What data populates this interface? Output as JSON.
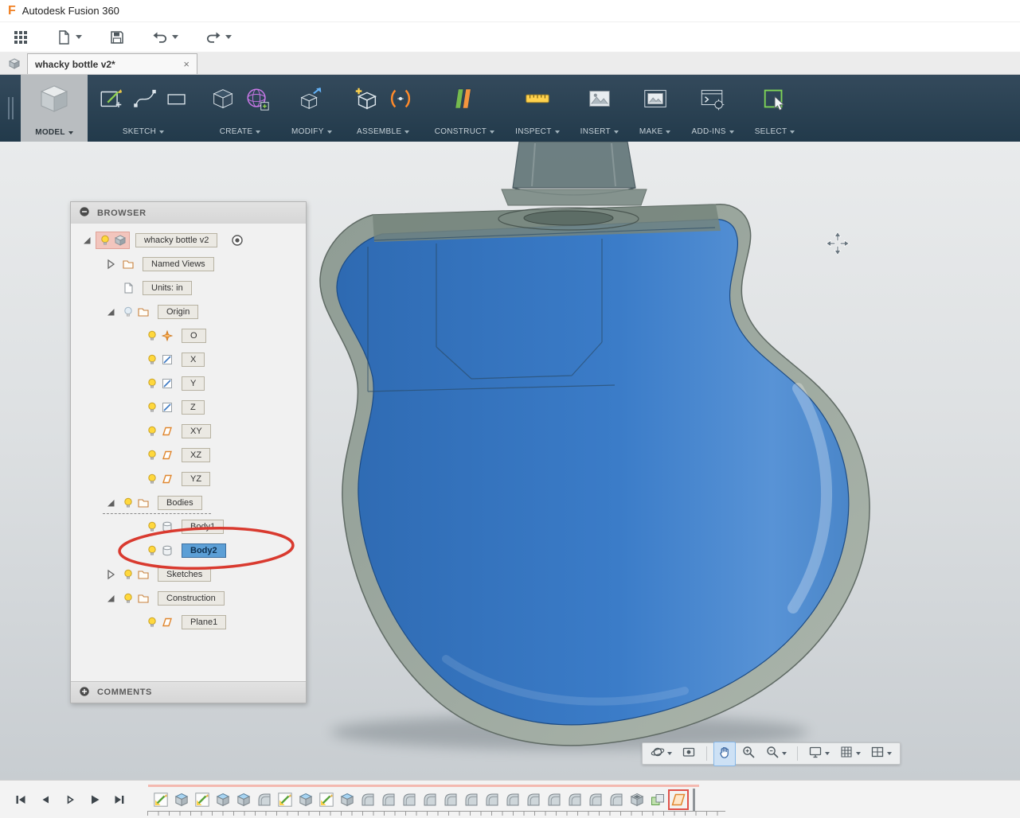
{
  "window": {
    "title": "Autodesk Fusion 360"
  },
  "quick_access": {
    "buttons": [
      {
        "name": "app-launcher-button",
        "icon": "app-grid-icon",
        "caret": false
      },
      {
        "name": "file-menu-button",
        "icon": "file-icon",
        "caret": true
      },
      {
        "name": "save-button",
        "icon": "save-icon",
        "caret": false
      },
      {
        "name": "undo-button",
        "icon": "undo-icon",
        "caret": true
      },
      {
        "name": "redo-button",
        "icon": "redo-icon",
        "caret": true
      }
    ]
  },
  "document_tab": {
    "label": "whacky bottle v2*",
    "close": "×"
  },
  "ribbon": {
    "model_label": "MODEL",
    "groups": [
      {
        "label": "SKETCH",
        "icons": [
          "create-sketch-icon",
          "spline-icon",
          "rectangle-icon"
        ]
      },
      {
        "label": "CREATE",
        "icons": [
          "box-icon",
          "form-icon"
        ]
      },
      {
        "label": "MODIFY",
        "icons": [
          "press-pull-icon"
        ]
      },
      {
        "label": "ASSEMBLE",
        "icons": [
          "new-component-icon",
          "joint-icon"
        ]
      },
      {
        "label": "CONSTRUCT",
        "icons": [
          "construction-plane-icon"
        ]
      },
      {
        "label": "INSPECT",
        "icons": [
          "measure-icon"
        ]
      },
      {
        "label": "INSERT",
        "icons": [
          "image-icon"
        ]
      },
      {
        "label": "MAKE",
        "icons": [
          "print-icon"
        ]
      },
      {
        "label": "ADD-INS",
        "icons": [
          "scripts-icon"
        ]
      },
      {
        "label": "SELECT",
        "icons": [
          "select-icon"
        ]
      }
    ]
  },
  "browser": {
    "header": "BROWSER",
    "comments_label": "COMMENTS",
    "items": [
      {
        "label": "whacky bottle v2",
        "depth": 0,
        "expander": "expanded",
        "bulb": "on",
        "icon": "component",
        "root": true,
        "radio": true
      },
      {
        "label": "Named Views",
        "depth": 1,
        "expander": "collapsed",
        "icon": "folder"
      },
      {
        "label": "Units: in",
        "depth": 1,
        "icon": "document"
      },
      {
        "label": "Origin",
        "depth": 1,
        "expander": "expanded",
        "bulb": "off",
        "icon": "folder"
      },
      {
        "label": "O",
        "depth": 2,
        "bulb": "on",
        "icon": "origin-point"
      },
      {
        "label": "X",
        "depth": 2,
        "bulb": "on",
        "icon": "axis"
      },
      {
        "label": "Y",
        "depth": 2,
        "bulb": "on",
        "icon": "axis"
      },
      {
        "label": "Z",
        "depth": 2,
        "bulb": "on",
        "icon": "axis"
      },
      {
        "label": "XY",
        "depth": 2,
        "bulb": "on",
        "icon": "plane"
      },
      {
        "label": "XZ",
        "depth": 2,
        "bulb": "on",
        "icon": "plane"
      },
      {
        "label": "YZ",
        "depth": 2,
        "bulb": "on",
        "icon": "plane"
      },
      {
        "label": "Bodies",
        "depth": 1,
        "expander": "expanded",
        "bulb": "on",
        "icon": "folder",
        "dotted": true
      },
      {
        "label": "Body1",
        "depth": 2,
        "bulb": "on",
        "icon": "body"
      },
      {
        "label": "Body2",
        "depth": 2,
        "bulb": "on",
        "icon": "body",
        "selected": true,
        "annotated": true
      },
      {
        "label": "Sketches",
        "depth": 1,
        "expander": "collapsed",
        "bulb": "on",
        "icon": "folder"
      },
      {
        "label": "Construction",
        "depth": 1,
        "expander": "expanded",
        "bulb": "on",
        "icon": "folder"
      },
      {
        "label": "Plane1",
        "depth": 2,
        "bulb": "on",
        "icon": "plane"
      }
    ]
  },
  "navbar": {
    "items": [
      {
        "name": "orbit",
        "icon": "orbit-icon",
        "caret": true
      },
      {
        "name": "look-at",
        "icon": "look-at-icon"
      },
      {
        "sep": true
      },
      {
        "name": "pan",
        "icon": "pan-icon",
        "active": true
      },
      {
        "name": "zoom",
        "icon": "zoom-icon"
      },
      {
        "name": "zoom-window",
        "icon": "zoom-window-icon",
        "caret": true
      },
      {
        "sep": true
      },
      {
        "name": "display-settings",
        "icon": "display-settings-icon",
        "caret": true
      },
      {
        "name": "grid-display",
        "icon": "grid-display-icon",
        "caret": true
      },
      {
        "name": "viewports",
        "icon": "viewports-icon",
        "caret": true
      }
    ]
  },
  "timeline": {
    "playback": [
      "go-to-start",
      "step-back",
      "step-forward",
      "play",
      "go-to-end"
    ],
    "features": [
      "sketch",
      "extrude",
      "sketch",
      "extrude",
      "extrude",
      "fillet",
      "sketch",
      "extrude",
      "sketch",
      "extrude",
      "fillet",
      "fillet",
      "fillet",
      "fillet",
      "fillet",
      "fillet",
      "fillet",
      "fillet",
      "fillet",
      "fillet",
      "fillet",
      "fillet",
      "fillet",
      "shell",
      "combine",
      "plane"
    ]
  },
  "colors": {
    "accent_orange": "#f08023",
    "selection_blue": "#5c9fd6",
    "annotation_red": "#d93a2f",
    "toolbar_bg": "#2c4254",
    "body_blue": "#3b7cc8",
    "shell_gray": "#9aa79d"
  }
}
